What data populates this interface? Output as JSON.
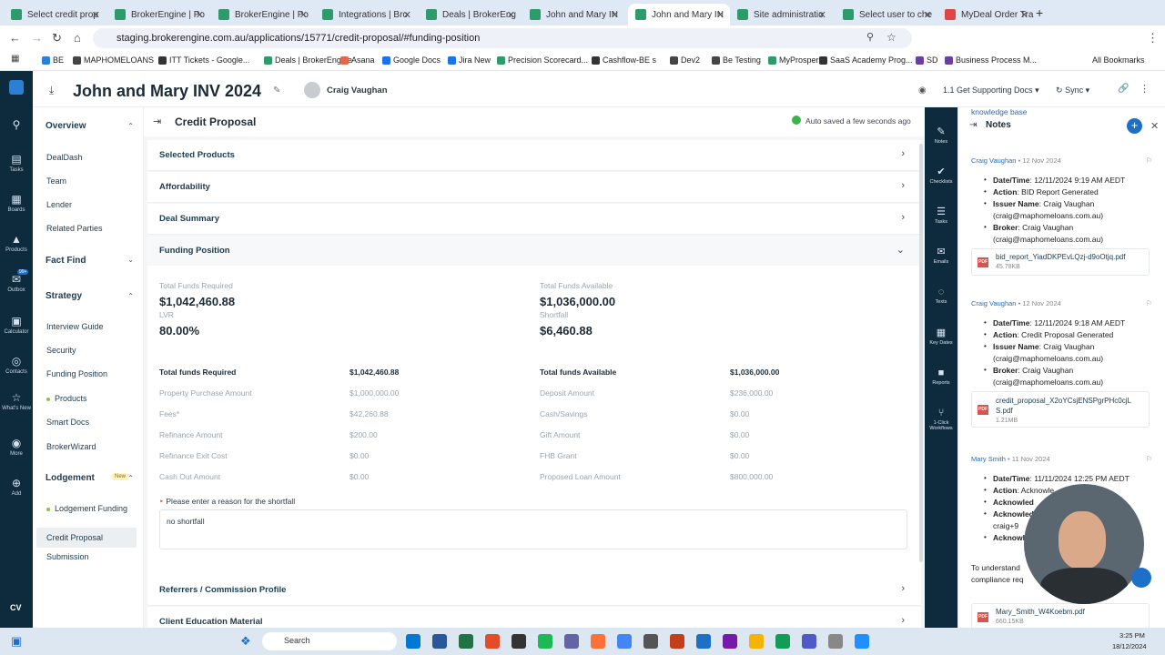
{
  "browser": {
    "tabs": [
      {
        "label": "Select credit prop",
        "color": "#2d9c6a"
      },
      {
        "label": "BrokerEngine | Po",
        "color": "#2d9c6a"
      },
      {
        "label": "BrokerEngine | Po",
        "color": "#2d9c6a"
      },
      {
        "label": "Integrations | Bro",
        "color": "#2d9c6a"
      },
      {
        "label": "Deals | BrokerEng",
        "color": "#2d9c6a"
      },
      {
        "label": "John and Mary IN",
        "color": "#2d9c6a"
      },
      {
        "label": "John and Mary IN",
        "color": "#2d9c6a"
      },
      {
        "label": "Site administratio",
        "color": "#2d9c6a"
      },
      {
        "label": "Select user to che",
        "color": "#2d9c6a"
      },
      {
        "label": "MyDeal Order Tra",
        "color": "#e04444"
      }
    ],
    "url": "staging.brokerengine.com.au/applications/15771/credit-proposal/#funding-position",
    "bookmarks": [
      "BE",
      "MAPHOMELOANS",
      "ITT Tickets - Google...",
      "Deals | BrokerEngine",
      "Asana",
      "Google Docs",
      "Jira New",
      "Precision Scorecard...",
      "Cashflow-BE s",
      "Dev2",
      "Be Testing",
      "MyProsperity",
      "SaaS Academy Prog...",
      "SD",
      "Business Process M..."
    ],
    "all_bookmarks": "All Bookmarks"
  },
  "rail": [
    "Tasks",
    "Boards",
    "Products",
    "Outbox",
    "Calculator",
    "Contacts",
    "What's New",
    "More",
    "Add"
  ],
  "rail_badge": "99+",
  "rail_user": "CV",
  "header": {
    "title": "John and Mary INV 2024",
    "user": "Craig Vaughan",
    "task_dropdown": "1.1 Get Supporting Docs",
    "sync": "Sync"
  },
  "leftnav": {
    "overview": "Overview",
    "overview_items": [
      "DealDash",
      "Team",
      "Lender",
      "Related Parties"
    ],
    "fact_find": "Fact Find",
    "strategy": "Strategy",
    "strategy_items": [
      "Interview Guide",
      "Security",
      "Funding Position",
      "Products",
      "Smart Docs",
      "BrokerWizard"
    ],
    "lodgement": "Lodgement",
    "new_badge": "New",
    "lodgement_items": [
      "Lodgement Funding",
      "Credit Proposal",
      "Submission"
    ]
  },
  "main": {
    "section_title": "Credit Proposal",
    "autosave": "Auto saved a few seconds ago",
    "accordions": [
      "Selected Products",
      "Affordability",
      "Deal Summary",
      "Funding Position"
    ],
    "summary": {
      "total_funds_required_label": "Total Funds Required",
      "total_funds_required": "$1,042,460.88",
      "lvr_label": "LVR",
      "lvr": "80.00%",
      "total_funds_available_label": "Total Funds Available",
      "total_funds_available": "$1,036,000.00",
      "shortfall_label": "Shortfall",
      "shortfall": "$6,460.88"
    },
    "required_rows": [
      {
        "label": "Total funds Required",
        "value": "$1,042,460.88"
      },
      {
        "label": "Property Purchase Amount",
        "value": "$1,000,000.00"
      },
      {
        "label": "Fees*",
        "value": "$42,260.88"
      },
      {
        "label": "Refinance Amount",
        "value": "$200.00"
      },
      {
        "label": "Refinance Exit Cost",
        "value": "$0.00"
      },
      {
        "label": "Cash Out Amount",
        "value": "$0.00"
      }
    ],
    "available_rows": [
      {
        "label": "Total funds Available",
        "value": "$1,036,000.00"
      },
      {
        "label": "Deposit Amount",
        "value": "$236,000.00"
      },
      {
        "label": "Cash/Savings",
        "value": "$0.00"
      },
      {
        "label": "Gift Amount",
        "value": "$0.00"
      },
      {
        "label": "FHB Grant",
        "value": "$0.00"
      },
      {
        "label": "Proposed Loan Amount",
        "value": "$800,000.00"
      }
    ],
    "shortfall_prompt": "Please enter a reason for the shortfall",
    "shortfall_reason": "no shortfall",
    "lower_accordions": [
      "Referrers / Commission Profile",
      "Client Education Material"
    ]
  },
  "tools": [
    "Notes",
    "Checklists",
    "Tasks",
    "Emails",
    "Texts",
    "Key Dates",
    "Reports",
    "1-Click Workflows"
  ],
  "notes": {
    "title": "Notes",
    "entries": [
      {
        "author": "Craig Vaughan",
        "date": "12 Nov 2024",
        "lines": [
          {
            "k": "Date/Time",
            "v": ": 12/11/2024 9:19 AM AEDT"
          },
          {
            "k": "Action",
            "v": ": BID Report Generated"
          },
          {
            "k": "Issuer Name",
            "v": ": Craig Vaughan"
          },
          {
            "k": "",
            "v": "(craig@maphomeloans.com.au)"
          },
          {
            "k": "Broker",
            "v": ": Craig Vaughan"
          },
          {
            "k": "",
            "v": "(craig@maphomeloans.com.au)"
          }
        ],
        "file": "bid_report_YiadDKPEvLQzj-d9oOtjq.pdf",
        "size": "45.78KB"
      },
      {
        "author": "Craig Vaughan",
        "date": "12 Nov 2024",
        "lines": [
          {
            "k": "Date/Time",
            "v": ": 12/11/2024 9:18 AM AEDT"
          },
          {
            "k": "Action",
            "v": ": Credit Proposal Generated"
          },
          {
            "k": "Issuer Name",
            "v": ": Craig Vaughan"
          },
          {
            "k": "",
            "v": "(craig@maphomeloans.com.au)"
          },
          {
            "k": "Broker",
            "v": ": Craig Vaughan"
          },
          {
            "k": "",
            "v": "(craig@maphomeloans.com.au)"
          }
        ],
        "file": "credit_proposal_X2oYCsjENSPgrPHc0cjL S.pdf",
        "size": "1.21MB"
      },
      {
        "author": "Mary Smith",
        "date": "11 Nov 2024",
        "lines": [
          {
            "k": "Date/Time",
            "v": ": 11/11/2024 12:25 PM AEDT"
          },
          {
            "k": "Action",
            "v": ": Acknowle"
          },
          {
            "k": "Acknowled",
            "v": ""
          },
          {
            "k": "Acknowled",
            "v": ""
          },
          {
            "k": "",
            "v": "craig+9"
          },
          {
            "k": "Acknowl",
            "v": ""
          }
        ],
        "tail": "To understand",
        "tail2": "compliance req",
        "tail3": "knowledge base",
        "file": "Mary_Smith_W4Koebm.pdf",
        "size": "660.15KB"
      }
    ]
  },
  "taskbar": {
    "search": "Search",
    "time": "3:25 PM",
    "date": "18/12/2024"
  }
}
